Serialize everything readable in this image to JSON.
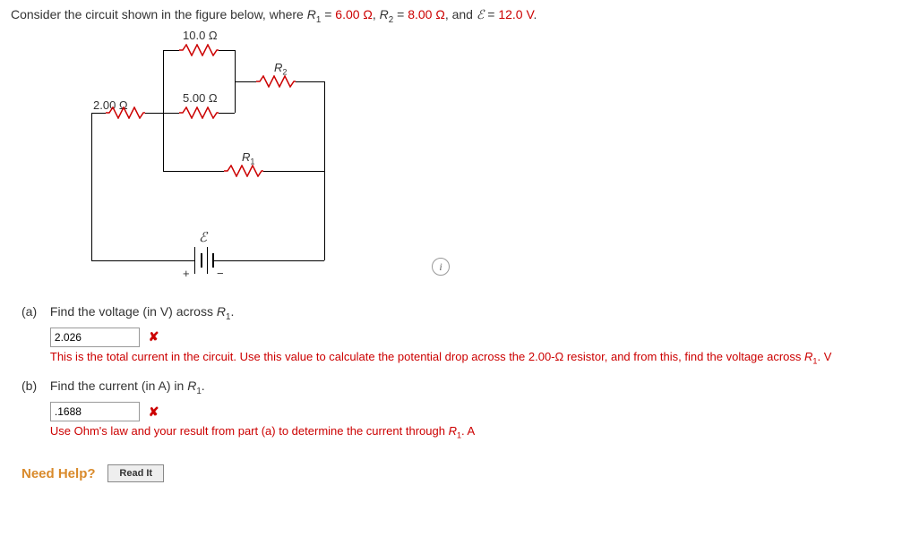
{
  "intro": {
    "prefix": "Consider the circuit shown in the figure below, where ",
    "r1_var": "R",
    "r1_sub": "1",
    "eq": " = ",
    "r1_val": "6.00 Ω",
    "sep1": ", ",
    "r2_var": "R",
    "r2_sub": "2",
    "r2_val": "8.00 Ω",
    "sep2": ", and ",
    "emf_sym": "ℰ",
    "emf_val": "12.0 V",
    "end": "."
  },
  "circuit": {
    "top_res": "10.0 Ω",
    "mid_res": "5.00 Ω",
    "left_res": "2.00 Ω",
    "r1_label": "R",
    "r1_sub": "1",
    "r2_label": "R",
    "r2_sub": "2",
    "emf": "ℰ",
    "plus": "+",
    "minus": "−"
  },
  "info_icon": "i",
  "part_a": {
    "label": "(a)",
    "prompt_pre": "Find the voltage (in V) across ",
    "var": "R",
    "sub": "1",
    "prompt_post": ".",
    "value": "2.026",
    "feedback_pre": "This is the total current in the circuit. Use this value to calculate the potential drop across the 2.00-Ω resistor, and from this, find the voltage across ",
    "fb_var": "R",
    "fb_sub": "1",
    "feedback_post": ".",
    "unit": " V"
  },
  "part_b": {
    "label": "(b)",
    "prompt_pre": "Find the current (in A) in ",
    "var": "R",
    "sub": "1",
    "prompt_post": ".",
    "value": ".1688",
    "feedback_pre": "Use Ohm's law and your result from part (a) to determine the current through ",
    "fb_var": "R",
    "fb_sub": "1",
    "feedback_post": ".",
    "unit": " A"
  },
  "help": {
    "label": "Need Help?",
    "button": "Read It"
  }
}
